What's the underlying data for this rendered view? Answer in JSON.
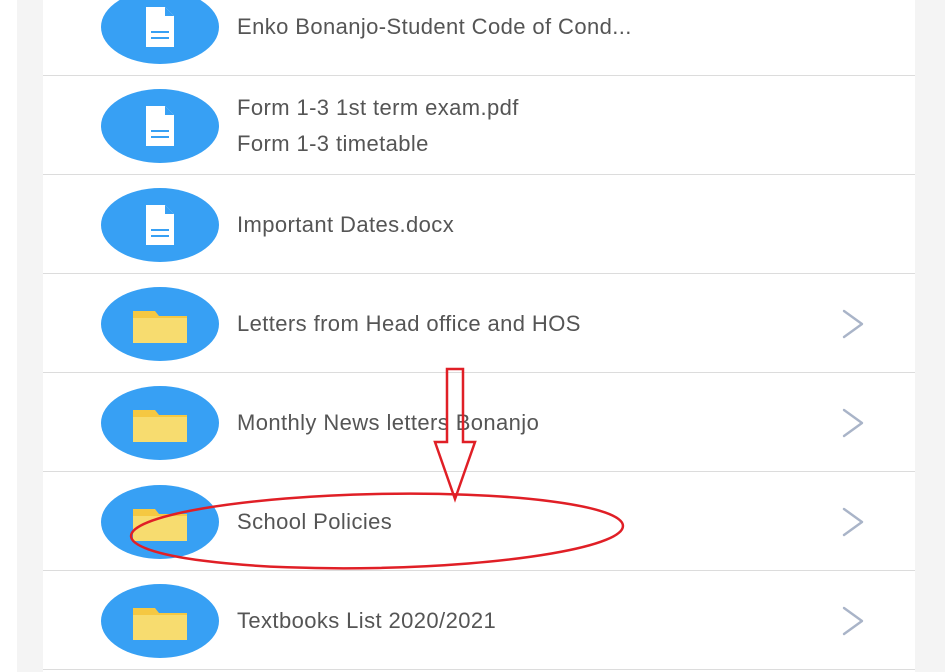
{
  "files": {
    "items": [
      {
        "kind": "document",
        "icon": "document-icon",
        "lines": [
          "Enko Bonanjo-Student Code of Cond..."
        ],
        "has_chevron": false
      },
      {
        "kind": "document",
        "icon": "document-icon",
        "lines": [
          "Form 1-3 1st term exam.pdf",
          "Form 1-3 timetable"
        ],
        "has_chevron": false
      },
      {
        "kind": "document",
        "icon": "document-icon",
        "lines": [
          "Important Dates.docx"
        ],
        "has_chevron": false
      },
      {
        "kind": "folder",
        "icon": "folder-icon",
        "lines": [
          "Letters from Head office and HOS"
        ],
        "has_chevron": true
      },
      {
        "kind": "folder",
        "icon": "folder-icon",
        "lines": [
          "Monthly News letters Bonanjo"
        ],
        "has_chevron": true
      },
      {
        "kind": "folder",
        "icon": "folder-icon",
        "lines": [
          "School Policies"
        ],
        "has_chevron": true
      },
      {
        "kind": "folder",
        "icon": "folder-icon",
        "lines": [
          "Textbooks List 2020/2021"
        ],
        "has_chevron": true
      }
    ]
  },
  "colors": {
    "icon_circle": "#37a0f4",
    "folder_fill": "#f7dc6f",
    "folder_tab": "#f5c842",
    "chevron": "#a9b4c8",
    "text": "#555555",
    "annotation": "#e01f26"
  },
  "annotations": {
    "arrow": "down-arrow-icon",
    "highlight": "ellipse-highlight-icon"
  }
}
